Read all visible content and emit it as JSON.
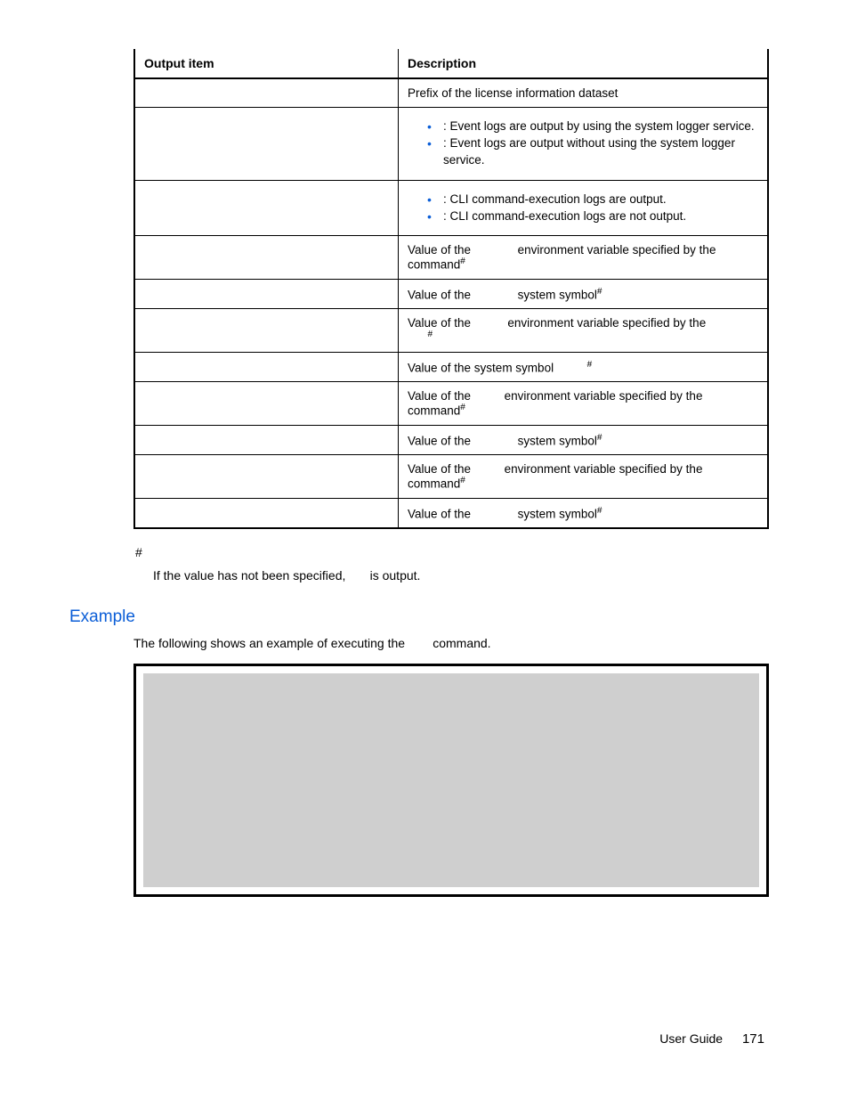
{
  "table": {
    "headers": {
      "col1": "Output item",
      "col2": "Description"
    },
    "rows": [
      {
        "desc": "Prefix of the license information dataset"
      },
      {
        "bullets": [
          ": Event logs are output by using the system logger service.",
          ": Event logs are output without using the system logger service."
        ]
      },
      {
        "bullets": [
          ": CLI command-execution logs are output.",
          ": CLI command-execution logs are not output."
        ]
      },
      {
        "desc_a": "Value of the ",
        "desc_b": " environment variable specified by the ",
        "desc_c": " command",
        "sup": "#"
      },
      {
        "desc_a": "Value of the ",
        "desc_b": " system symbol",
        "sup": "#"
      },
      {
        "desc_a": "Value of the ",
        "desc_b": " environment variable specified by the ",
        "sup": "#"
      },
      {
        "desc_a": "Value of the system symbol ",
        "sup": "#"
      },
      {
        "desc_a": "Value of the ",
        "desc_b": " environment variable specified by the ",
        "desc_c": " command",
        "sup": "#"
      },
      {
        "desc_a": "Value of the ",
        "desc_b": " system symbol",
        "sup": "#"
      },
      {
        "desc_a": "Value of the ",
        "desc_b": " environment variable specified by the ",
        "desc_c": " command",
        "sup": "#"
      },
      {
        "desc_a": "Value of the ",
        "desc_b": " system symbol",
        "sup": "#"
      }
    ]
  },
  "footnote": {
    "mark": "#",
    "text_a": "If the value has not been specified, ",
    "text_b": " is output."
  },
  "section": {
    "heading": "Example",
    "desc_a": "The following shows an example of executing the ",
    "desc_b": " command."
  },
  "footer": {
    "label": "User Guide",
    "page": "171"
  }
}
